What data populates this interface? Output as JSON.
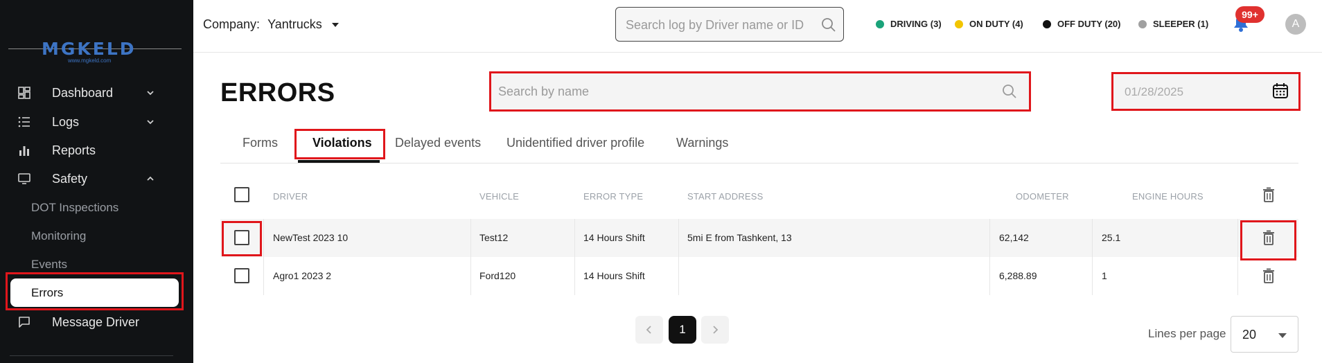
{
  "logo": {
    "text": "MGKELD",
    "subtext": "www.mgkeld.com",
    "brand_color": "#3d74c4"
  },
  "sidebar": {
    "items": [
      {
        "label": "Dashboard",
        "icon": "dashboard-icon",
        "chevron": "down"
      },
      {
        "label": "Logs",
        "icon": "list-icon",
        "chevron": "down"
      },
      {
        "label": "Reports",
        "icon": "bar-chart-icon"
      },
      {
        "label": "Safety",
        "icon": "monitor-icon",
        "chevron": "up"
      }
    ],
    "safety_subitems": [
      "DOT Inspections",
      "Monitoring",
      "Events",
      "Errors"
    ],
    "message_driver": "Message Driver",
    "active_item": "Errors"
  },
  "header": {
    "company_label": "Company:",
    "company_name": "Yantrucks",
    "search_placeholder": "Search log by Driver name or ID",
    "statuses": [
      {
        "label": "DRIVING (3)",
        "color": "#1aa37a"
      },
      {
        "label": "ON DUTY (4)",
        "color": "#f2c500"
      },
      {
        "label": "OFF DUTY (20)",
        "color": "#111111"
      },
      {
        "label": "SLEEPER (1)",
        "color": "#a0a0a0"
      }
    ],
    "notification_badge": "99+",
    "avatar_initial": "A"
  },
  "main": {
    "title": "ERRORS",
    "search_placeholder": "Search by name",
    "date_value": "01/28/2025",
    "tabs": [
      "Forms",
      "Violations",
      "Delayed events",
      "Unidentified driver profile",
      "Warnings"
    ],
    "active_tab": "Violations"
  },
  "table": {
    "columns": [
      "DRIVER",
      "VEHICLE",
      "ERROR TYPE",
      "START ADDRESS",
      "ODOMETER",
      "ENGINE HOURS"
    ],
    "rows": [
      {
        "driver": "NewTest 2023 10",
        "vehicle": "Test12",
        "error_type": "14 Hours Shift",
        "start_address": "5mi E from Tashkent, 13",
        "odometer": "62,142",
        "engine_hours": "25.1"
      },
      {
        "driver": "Agro1 2023 2",
        "vehicle": "Ford120",
        "error_type": "14 Hours Shift",
        "start_address": "",
        "odometer": "6,288.89",
        "engine_hours": "1"
      }
    ]
  },
  "pagination": {
    "current_page": "1",
    "lines_label": "Lines per page",
    "lines_value": "20"
  },
  "highlight_color": "#e0161b"
}
